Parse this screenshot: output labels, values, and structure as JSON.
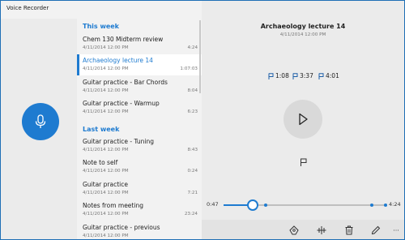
{
  "app": {
    "title": "Voice Recorder",
    "accent_color": "#1e7bd0"
  },
  "window_controls": [
    {
      "name": "minimize",
      "glyph": "—"
    },
    {
      "name": "maximize",
      "glyph": "☐"
    },
    {
      "name": "close",
      "glyph": "✕"
    }
  ],
  "record_button": {
    "icon": "microphone-icon"
  },
  "recordings": {
    "groups": [
      {
        "header": "This week",
        "items": [
          {
            "name": "Chem 130 Midterm review",
            "date": "4/11/2014 12:00 PM",
            "duration": "4:24",
            "selected": false
          },
          {
            "name": "Archaeology lecture 14",
            "date": "4/11/2014 12:00 PM",
            "duration": "1:07:03",
            "selected": true
          },
          {
            "name": "Guitar practice - Bar Chords",
            "date": "4/11/2014 12:00 PM",
            "duration": "8:04",
            "selected": false
          },
          {
            "name": "Guitar practice - Warmup",
            "date": "4/11/2014 12:00 PM",
            "duration": "6:23",
            "selected": false
          }
        ]
      },
      {
        "header": "Last week",
        "items": [
          {
            "name": "Guitar practice - Tuning",
            "date": "4/11/2014 12:00 PM",
            "duration": "8:43",
            "selected": false
          },
          {
            "name": "Note to self",
            "date": "4/11/2014 12:00 PM",
            "duration": "0:24",
            "selected": false
          },
          {
            "name": "Guitar practice",
            "date": "4/11/2014 12:00 PM",
            "duration": "7:21",
            "selected": false
          },
          {
            "name": "Notes from meeting",
            "date": "4/11/2014 12:00 PM",
            "duration": "23:24",
            "selected": false
          },
          {
            "name": "Guitar practice - previous",
            "date": "4/11/2014 12:00 PM",
            "duration": "",
            "selected": false
          }
        ]
      }
    ]
  },
  "detail": {
    "title": "Archaeology lecture 14",
    "date": "4/11/2014 12:00 PM",
    "markers": [
      "1:08",
      "3:37",
      "4:01"
    ],
    "play_icon": "play-icon",
    "add_marker_icon": "flag-icon"
  },
  "playback": {
    "current_time": "0:47",
    "total_time": "4:24",
    "progress_fraction": 0.178,
    "marker_fractions": [
      0.258,
      0.914,
      1.0
    ]
  },
  "command_bar": {
    "icons": [
      "share-icon",
      "trim-icon",
      "delete-icon",
      "rename-icon",
      "more-icon"
    ],
    "more_glyph": "···"
  }
}
